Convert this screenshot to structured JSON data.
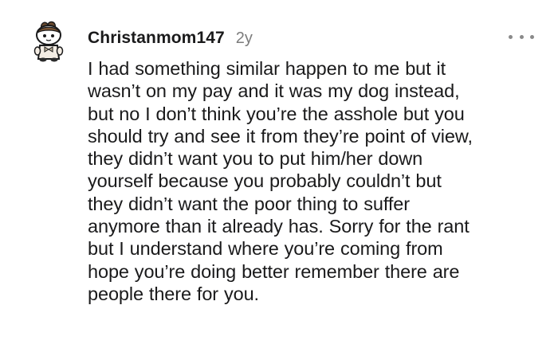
{
  "comment": {
    "username": "Christanmom147",
    "age": "2y",
    "more_label": "•••",
    "avatar_icon": "snoo-avatar-icon",
    "lines": [
      "I had something similar happen to me but it",
      "wasn’t on my pay and it was my dog instead,",
      "but no I don’t think you’re the asshole but you",
      "should try and see it from they’re point of view,",
      "they didn’t want you to put him/her down",
      "yourself because you probably couldn’t but",
      "they didn’t want the poor thing to suffer",
      "anymore than it already has. Sorry for the rant",
      "but I understand where you’re coming from",
      "hope you’re doing better remember there are",
      "people there for you."
    ]
  }
}
